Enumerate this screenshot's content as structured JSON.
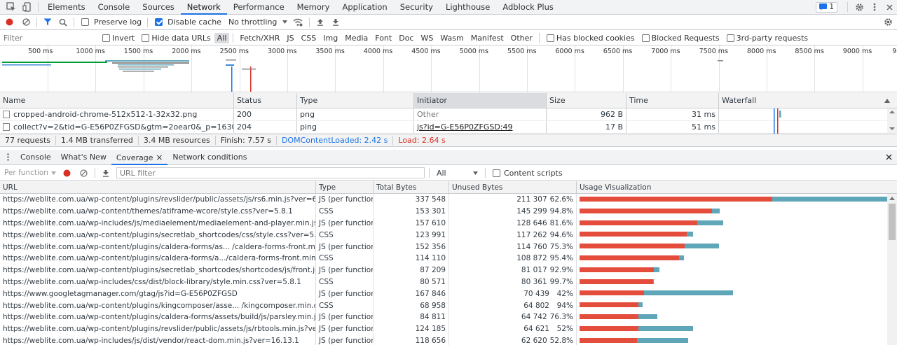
{
  "tabs": [
    "Elements",
    "Console",
    "Sources",
    "Network",
    "Performance",
    "Memory",
    "Application",
    "Security",
    "Lighthouse",
    "Adblock Plus"
  ],
  "active_tab": "Network",
  "issues_badge": "1",
  "toolbar": {
    "preserve_log": "Preserve log",
    "disable_cache": "Disable cache",
    "throttling": "No throttling"
  },
  "filter": {
    "placeholder": "Filter",
    "invert": "Invert",
    "hide_data_urls": "Hide data URLs",
    "types": [
      "All",
      "Fetch/XHR",
      "JS",
      "CSS",
      "Img",
      "Media",
      "Font",
      "Doc",
      "WS",
      "Wasm",
      "Manifest",
      "Other"
    ],
    "blocked_cookies": "Has blocked cookies",
    "blocked_requests": "Blocked Requests",
    "third_party": "3rd-party requests"
  },
  "timeline_ticks": [
    "500 ms",
    "1000 ms",
    "1500 ms",
    "2000 ms",
    "2500 ms",
    "3000 ms",
    "3500 ms",
    "4000 ms",
    "4500 ms",
    "5000 ms",
    "5500 ms",
    "6000 ms",
    "6500 ms",
    "7000 ms",
    "7500 ms",
    "8000 ms",
    "8500 ms",
    "9000 ms",
    "9500"
  ],
  "requests": {
    "headers": {
      "name": "Name",
      "status": "Status",
      "type": "Type",
      "initiator": "Initiator",
      "size": "Size",
      "time": "Time",
      "waterfall": "Waterfall"
    },
    "rows": [
      {
        "name": "cropped-android-chrome-512x512-1-32x32.png",
        "status": "200",
        "type": "png",
        "initiator": "Other",
        "size": "962 B",
        "time": "31 ms"
      },
      {
        "name": "collect?v=2&tid=G-E56P0ZFGSD&gtm=2oear0&_p=1630801...0We...",
        "status": "204",
        "type": "ping",
        "initiator": "js?id=G-E56P0ZFGSD:49",
        "size": "17 B",
        "time": "51 ms"
      }
    ]
  },
  "status": {
    "requests": "77 requests",
    "transferred": "1.4 MB transferred",
    "resources": "3.4 MB resources",
    "finish": "Finish: 7.57 s",
    "dcl": "DOMContentLoaded: 2.42 s",
    "load": "Load: 2.64 s"
  },
  "drawer_tabs": [
    "Console",
    "What's New",
    "Coverage",
    "Network conditions"
  ],
  "active_drawer": "Coverage",
  "coverage": {
    "per_function": "Per function",
    "url_filter_placeholder": "URL filter",
    "all_option": "All",
    "content_scripts": "Content scripts",
    "headers": {
      "url": "URL",
      "type": "Type",
      "total": "Total Bytes",
      "unused": "Unused Bytes",
      "viz": "Usage Visualization"
    },
    "colors": {
      "unused": "#e44d3c",
      "used": "#5fa6b8"
    },
    "rows": [
      {
        "url": "https://weblite.com.ua/wp-content/plugins/revslider/public/assets/js/rs6.min.js?ver=6.3.9",
        "type": "JS (per function)",
        "total": "337 548",
        "unused": "211 307",
        "pct": "62.6%",
        "total_n": 337548,
        "unused_n": 211307
      },
      {
        "url": "https://weblite.com.ua/wp-content/themes/atiframe-wcore/style.css?ver=5.8.1",
        "type": "CSS",
        "total": "153 301",
        "unused": "145 299",
        "pct": "94.8%",
        "total_n": 153301,
        "unused_n": 145299
      },
      {
        "url": "https://weblite.com.ua/wp-includes/js/mediaelement/mediaelement-and-player.min.js?ver=4.2.16",
        "type": "JS (per function)",
        "total": "157 610",
        "unused": "128 646",
        "pct": "81.6%",
        "total_n": 157610,
        "unused_n": 128646
      },
      {
        "url": "https://weblite.com.ua/wp-content/plugins/secretlab_shortcodes/css/style.css?ver=5.8.1",
        "type": "CSS",
        "total": "123 991",
        "unused": "117 262",
        "pct": "94.6%",
        "total_n": 123991,
        "unused_n": 117262
      },
      {
        "url": "https://weblite.com.ua/wp-content/plugins/caldera-forms/as... /caldera-forms-front.min.js?ver=1.9.3",
        "type": "JS (per function)",
        "total": "152 356",
        "unused": "114 760",
        "pct": "75.3%",
        "total_n": 152356,
        "unused_n": 114760
      },
      {
        "url": "https://weblite.com.ua/wp-content/plugins/caldera-forms/a.../caldera-forms-front.min.css?ver=1.9.3",
        "type": "CSS",
        "total": "114 110",
        "unused": "108 872",
        "pct": "95.4%",
        "total_n": 114110,
        "unused_n": 108872
      },
      {
        "url": "https://weblite.com.ua/wp-content/plugins/secretlab_shortcodes/shortcodes/js/front.js?ver=5.8.1",
        "type": "JS (per function)",
        "total": "87 209",
        "unused": "81 017",
        "pct": "92.9%",
        "total_n": 87209,
        "unused_n": 81017
      },
      {
        "url": "https://weblite.com.ua/wp-includes/css/dist/block-library/style.min.css?ver=5.8.1",
        "type": "CSS",
        "total": "80 571",
        "unused": "80 361",
        "pct": "99.7%",
        "total_n": 80571,
        "unused_n": 80361
      },
      {
        "url": "https://www.googletagmanager.com/gtag/js?id=G-E56P0ZFGSD",
        "type": "JS (per function)",
        "total": "167 846",
        "unused": "70 439",
        "pct": "42%",
        "total_n": 167846,
        "unused_n": 70439
      },
      {
        "url": "https://weblite.com.ua/wp-content/plugins/kingcomposer/asse... /kingcomposer.min.css?ver=3.9.5.3",
        "type": "CSS",
        "total": "68 958",
        "unused": "64 802",
        "pct": "94%",
        "total_n": 68958,
        "unused_n": 64802
      },
      {
        "url": "https://weblite.com.ua/wp-content/plugins/caldera-forms/assets/build/js/parsley.min.js?ver=1.9.3",
        "type": "JS (per function)",
        "total": "84 811",
        "unused": "64 742",
        "pct": "76.3%",
        "total_n": 84811,
        "unused_n": 64742
      },
      {
        "url": "https://weblite.com.ua/wp-content/plugins/revslider/public/assets/js/rbtools.min.js?ver=6.3.9",
        "type": "JS (per function)",
        "total": "124 185",
        "unused": "64 621",
        "pct": "52%",
        "total_n": 124185,
        "unused_n": 64621
      },
      {
        "url": "https://weblite.com.ua/wp-includes/js/dist/vendor/react-dom.min.js?ver=16.13.1",
        "type": "JS (per function)",
        "total": "118 656",
        "unused": "62 620",
        "pct": "52.8%",
        "total_n": 118656,
        "unused_n": 62620
      }
    ]
  }
}
